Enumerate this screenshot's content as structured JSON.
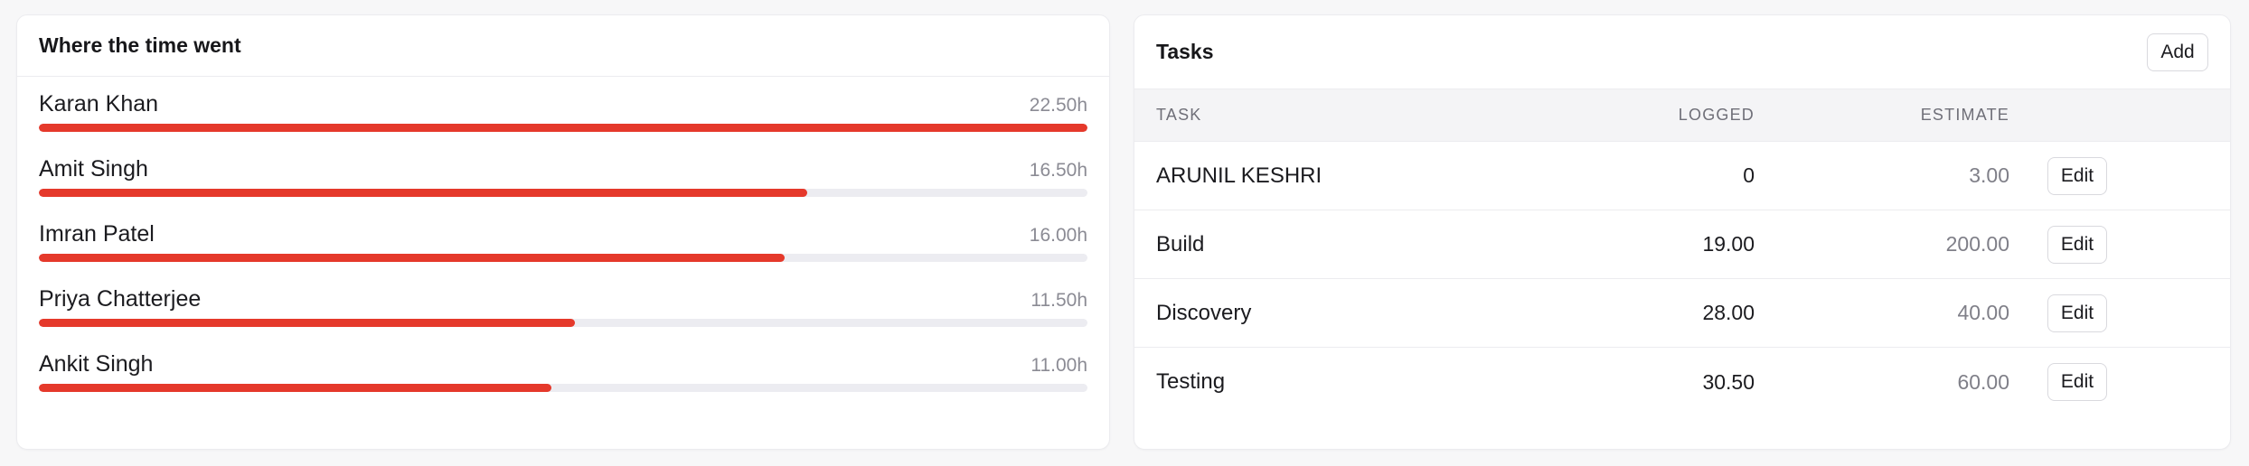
{
  "time_card": {
    "title": "Where the time went",
    "accent_color": "#e5392b",
    "track_color": "#ececf1",
    "people": [
      {
        "name": "Karan Khan",
        "hours": "22.50h",
        "progress": 1.0
      },
      {
        "name": "Amit Singh",
        "hours": "16.50h",
        "progress": 0.733
      },
      {
        "name": "Imran Patel",
        "hours": "16.00h",
        "progress": 0.711
      },
      {
        "name": "Priya Chatterjee",
        "hours": "11.50h",
        "progress": 0.511
      },
      {
        "name": "Ankit Singh",
        "hours": "11.00h",
        "progress": 0.489
      }
    ]
  },
  "tasks_card": {
    "title": "Tasks",
    "add_label": "Add",
    "columns": {
      "task": "TASK",
      "logged": "LOGGED",
      "estimate": "ESTIMATE",
      "actions": ""
    },
    "rows": [
      {
        "task": "ARUNIL KESHRI",
        "logged": "0",
        "estimate": "3.00",
        "action": "Edit"
      },
      {
        "task": "Build",
        "logged": "19.00",
        "estimate": "200.00",
        "action": "Edit"
      },
      {
        "task": "Discovery",
        "logged": "28.00",
        "estimate": "40.00",
        "action": "Edit"
      },
      {
        "task": "Testing",
        "logged": "30.50",
        "estimate": "60.00",
        "action": "Edit"
      }
    ]
  }
}
